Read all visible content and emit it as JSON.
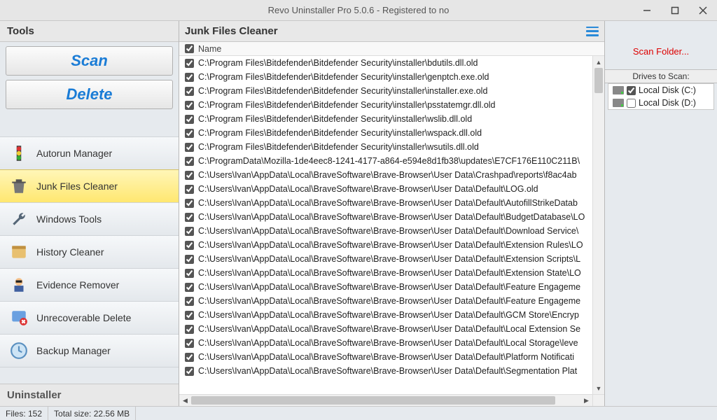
{
  "window": {
    "title": "Revo Uninstaller Pro 5.0.6 - Registered to no"
  },
  "sidebar": {
    "header": "Tools",
    "scan_label": "Scan",
    "delete_label": "Delete",
    "footer": "Uninstaller",
    "tools": [
      {
        "id": "autorun",
        "label": "Autorun Manager",
        "active": false
      },
      {
        "id": "junk",
        "label": "Junk Files Cleaner",
        "active": true
      },
      {
        "id": "wintools",
        "label": "Windows Tools",
        "active": false
      },
      {
        "id": "history",
        "label": "History Cleaner",
        "active": false
      },
      {
        "id": "evidence",
        "label": "Evidence Remover",
        "active": false
      },
      {
        "id": "unrecov",
        "label": "Unrecoverable Delete",
        "active": false
      },
      {
        "id": "backup",
        "label": "Backup Manager",
        "active": false
      }
    ]
  },
  "center": {
    "title": "Junk Files Cleaner",
    "column_header": "Name",
    "rows": [
      "C:\\Program Files\\Bitdefender\\Bitdefender Security\\installer\\bdutils.dll.old",
      "C:\\Program Files\\Bitdefender\\Bitdefender Security\\installer\\genptch.exe.old",
      "C:\\Program Files\\Bitdefender\\Bitdefender Security\\installer\\installer.exe.old",
      "C:\\Program Files\\Bitdefender\\Bitdefender Security\\installer\\psstatemgr.dll.old",
      "C:\\Program Files\\Bitdefender\\Bitdefender Security\\installer\\wslib.dll.old",
      "C:\\Program Files\\Bitdefender\\Bitdefender Security\\installer\\wspack.dll.old",
      "C:\\Program Files\\Bitdefender\\Bitdefender Security\\installer\\wsutils.dll.old",
      "C:\\ProgramData\\Mozilla-1de4eec8-1241-4177-a864-e594e8d1fb38\\updates\\E7CF176E110C211B\\",
      "C:\\Users\\Ivan\\AppData\\Local\\BraveSoftware\\Brave-Browser\\User Data\\Crashpad\\reports\\f8ac4ab",
      "C:\\Users\\Ivan\\AppData\\Local\\BraveSoftware\\Brave-Browser\\User Data\\Default\\LOG.old",
      "C:\\Users\\Ivan\\AppData\\Local\\BraveSoftware\\Brave-Browser\\User Data\\Default\\AutofillStrikeDatab",
      "C:\\Users\\Ivan\\AppData\\Local\\BraveSoftware\\Brave-Browser\\User Data\\Default\\BudgetDatabase\\LO",
      "C:\\Users\\Ivan\\AppData\\Local\\BraveSoftware\\Brave-Browser\\User Data\\Default\\Download Service\\",
      "C:\\Users\\Ivan\\AppData\\Local\\BraveSoftware\\Brave-Browser\\User Data\\Default\\Extension Rules\\LO",
      "C:\\Users\\Ivan\\AppData\\Local\\BraveSoftware\\Brave-Browser\\User Data\\Default\\Extension Scripts\\L",
      "C:\\Users\\Ivan\\AppData\\Local\\BraveSoftware\\Brave-Browser\\User Data\\Default\\Extension State\\LO",
      "C:\\Users\\Ivan\\AppData\\Local\\BraveSoftware\\Brave-Browser\\User Data\\Default\\Feature Engageme",
      "C:\\Users\\Ivan\\AppData\\Local\\BraveSoftware\\Brave-Browser\\User Data\\Default\\Feature Engageme",
      "C:\\Users\\Ivan\\AppData\\Local\\BraveSoftware\\Brave-Browser\\User Data\\Default\\GCM Store\\Encryp",
      "C:\\Users\\Ivan\\AppData\\Local\\BraveSoftware\\Brave-Browser\\User Data\\Default\\Local Extension Se",
      "C:\\Users\\Ivan\\AppData\\Local\\BraveSoftware\\Brave-Browser\\User Data\\Default\\Local Storage\\leve",
      "C:\\Users\\Ivan\\AppData\\Local\\BraveSoftware\\Brave-Browser\\User Data\\Default\\Platform Notificati",
      "C:\\Users\\Ivan\\AppData\\Local\\BraveSoftware\\Brave-Browser\\User Data\\Default\\Segmentation Plat"
    ]
  },
  "rightpanel": {
    "scan_folder_label": "Scan Folder...",
    "drives_header": "Drives to Scan:",
    "drives": [
      {
        "label": "Local Disk (C:)",
        "checked": true
      },
      {
        "label": "Local Disk (D:)",
        "checked": false
      }
    ]
  },
  "statusbar": {
    "files": "Files: 152",
    "total_size": "Total size: 22.56 MB"
  }
}
